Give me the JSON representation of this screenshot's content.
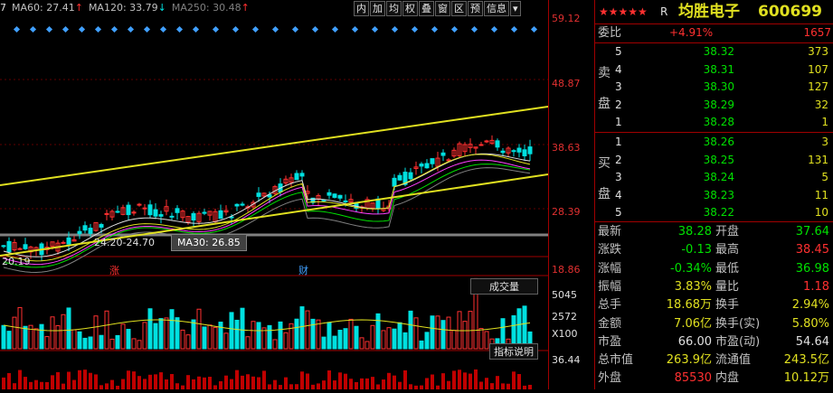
{
  "ma_legend": [
    {
      "label": "7",
      "color": "#e0e0e0"
    },
    {
      "label": "MA60: 27.41",
      "arrow": "↑",
      "color": "#c0c0c0",
      "arrow_color": "#ff3030"
    },
    {
      "label": "MA120: 33.79",
      "arrow": "↓",
      "color": "#c0c0c0",
      "arrow_color": "#00e0e0"
    },
    {
      "label": "MA250: 30.48",
      "arrow": "↑",
      "color": "#808080",
      "arrow_color": "#ff3030"
    }
  ],
  "toolbar": [
    "内",
    "加",
    "均",
    "权",
    "叠",
    "窗",
    "区",
    "预",
    "信息",
    "▾"
  ],
  "axis_ticks": [
    {
      "label": "59.12",
      "color": "#e03030"
    },
    {
      "label": "48.87",
      "color": "#e03030"
    },
    {
      "label": "38.63",
      "color": "#e03030"
    },
    {
      "label": "28.39",
      "color": "#e03030"
    },
    {
      "label": "18.86",
      "color": "#e03030"
    },
    {
      "label": "5045",
      "color": "#e0e0e0"
    },
    {
      "label": "2572",
      "color": "#e0e0e0"
    },
    {
      "label": "X100",
      "color": "#e0e0e0"
    },
    {
      "label": "36.44",
      "color": "#e0e0e0"
    }
  ],
  "annotations": {
    "low_label": "20.19",
    "range_label": "24.20-24.70",
    "ma30_tip": "MA30: 26.85",
    "event1": "涨",
    "event2": "财",
    "volume_label": "成交量",
    "indicator_label": "指标说明"
  },
  "stock": {
    "stars": "★★★★★",
    "mark": "R",
    "name": "均胜电子",
    "code": "600699"
  },
  "order_ratio": {
    "label": "委比",
    "pct": "+4.91%",
    "diff": "1657"
  },
  "sell_side_label": [
    "卖",
    "盘"
  ],
  "buy_side_label": [
    "买",
    "盘"
  ],
  "sell": [
    {
      "level": "5",
      "price": "38.32",
      "vol": "373"
    },
    {
      "level": "4",
      "price": "38.31",
      "vol": "107"
    },
    {
      "level": "3",
      "price": "38.30",
      "vol": "127"
    },
    {
      "level": "2",
      "price": "38.29",
      "vol": "32"
    },
    {
      "level": "1",
      "price": "38.28",
      "vol": "1"
    }
  ],
  "buy": [
    {
      "level": "1",
      "price": "38.26",
      "vol": "3"
    },
    {
      "level": "2",
      "price": "38.25",
      "vol": "131"
    },
    {
      "level": "3",
      "price": "38.24",
      "vol": "5"
    },
    {
      "level": "4",
      "price": "38.23",
      "vol": "11"
    },
    {
      "level": "5",
      "price": "38.22",
      "vol": "10"
    }
  ],
  "quote": [
    {
      "l1": "最新",
      "v1": "38.28",
      "c1": "green",
      "l2": "开盘",
      "v2": "37.64",
      "c2": "green"
    },
    {
      "l1": "涨跌",
      "v1": "-0.13",
      "c1": "green",
      "l2": "最高",
      "v2": "38.45",
      "c2": "red"
    },
    {
      "l1": "涨幅",
      "v1": "-0.34%",
      "c1": "green",
      "l2": "最低",
      "v2": "36.98",
      "c2": "green"
    },
    {
      "l1": "振幅",
      "v1": "3.83%",
      "c1": "yellow",
      "l2": "量比",
      "v2": "1.18",
      "c2": "red"
    },
    {
      "l1": "总手",
      "v1": "18.68万",
      "c1": "yellow",
      "l2": "换手",
      "v2": "2.94%",
      "c2": "yellow"
    },
    {
      "l1": "金额",
      "v1": "7.06亿",
      "c1": "yellow",
      "l2": "换手(实)",
      "v2": "5.80%",
      "c2": "yellow"
    },
    {
      "l1": "市盈",
      "v1": "66.00",
      "c1": "white",
      "l2": "市盈(动)",
      "v2": "54.64",
      "c2": "white"
    },
    {
      "l1": "总市值",
      "v1": "263.9亿",
      "c1": "yellow",
      "l2": "流通值",
      "v2": "243.5亿",
      "c2": "yellow"
    },
    {
      "l1": "外盘",
      "v1": "85530",
      "c1": "red",
      "l2": "内盘",
      "v2": "10.12万",
      "c2": "yellow"
    }
  ]
}
